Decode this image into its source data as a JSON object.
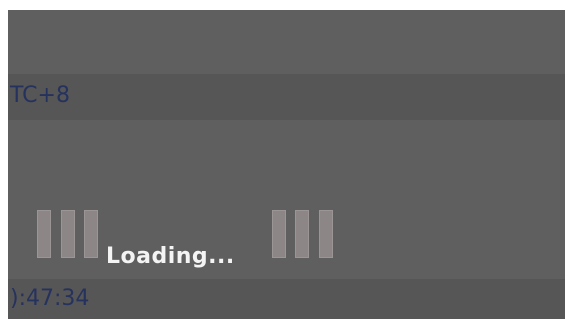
{
  "timezone_row": {
    "text": "TC+8"
  },
  "time_row": {
    "text": "):47:34"
  },
  "loading": {
    "label": "Loading..."
  },
  "colors": {
    "panel_background": "#5f5f5f",
    "row_background": "#565656",
    "row_text": "#26325e",
    "loader_bar": "#8c8686",
    "loading_text": "#f4f4f4"
  }
}
